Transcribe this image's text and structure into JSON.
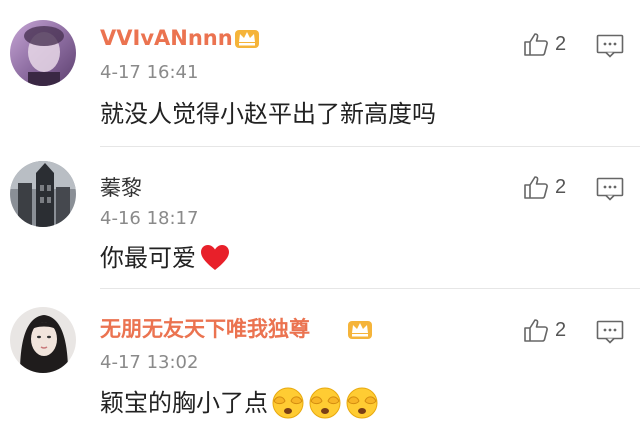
{
  "comments": [
    {
      "username": "VVIvANnnn",
      "time": "4-17 16:41",
      "text": "就没人觉得小赵平出了新高度吗",
      "likes": "2",
      "username_color": "#eb7350",
      "vip_badge": "crown-badge-icon"
    },
    {
      "username": "蓁黎",
      "time": "4-16 18:17",
      "text": "你最可爱",
      "likes": "2",
      "username_color": "#333333",
      "trailing_emoji": "red-heart-icon"
    },
    {
      "username": "无朋无友天下唯我独尊",
      "time": "4-17 13:02",
      "text": "颖宝的胸小了点",
      "likes": "2",
      "username_color": "#eb7350",
      "vip_badge": "crown-badge-icon",
      "trailing_emoji": "face-covering-eyes-emoji x3"
    }
  ],
  "colors": {
    "vip_name": "#eb7350",
    "meta_text": "#8a8a8a",
    "body_text": "#222222",
    "divider": "#e6e6e6"
  }
}
